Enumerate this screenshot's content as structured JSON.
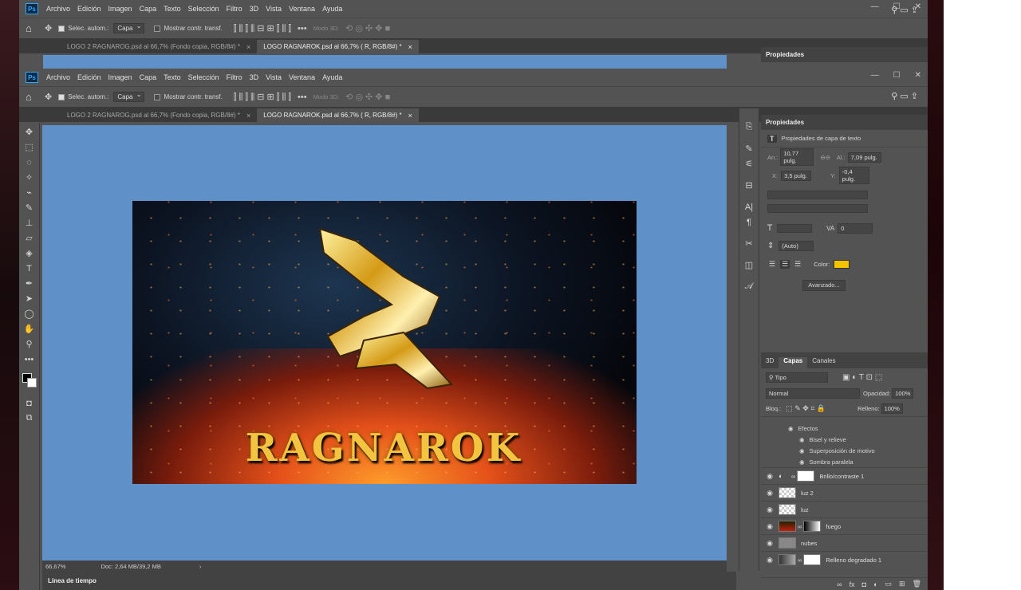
{
  "app_logo": "Ps",
  "menu": [
    "Archivo",
    "Edición",
    "Imagen",
    "Capa",
    "Texto",
    "Selección",
    "Filtro",
    "3D",
    "Vista",
    "Ventana",
    "Ayuda"
  ],
  "window_controls": {
    "minimize": "—",
    "maximize": "☐",
    "close": "✕"
  },
  "options": {
    "autoselect_label": "Selec. autom.:",
    "autoselect_value": "Capa",
    "transform_label": "Mostrar contr. transf.",
    "mode3d_label": "Modo 3D:",
    "more": "•••"
  },
  "tabs": [
    {
      "label": "LOGO 2 RAGNAROG.psd al 66,7% (Fondo copia, RGB/8#) *"
    },
    {
      "label": "LOGO RAGNAROK.psd al 66,7% ( R, RGB/8#) *"
    }
  ],
  "properties": {
    "title": "Propiedades",
    "subtitle": "Propiedades de capa de texto",
    "w_label": "An.:",
    "w_value": "10,77 pulg.",
    "h_label": "Al.:",
    "h_value": "7,09 pulg.",
    "x_label": "X:",
    "x_value": "3,5 pulg.",
    "y_label": "Y:",
    "y_value": "-0,4 pulg.",
    "tracking_value": "0",
    "leading_value": "(Auto)",
    "color_label": "Color:",
    "color": "#f5c400",
    "advanced_label": "Avanzado..."
  },
  "layers_panel": {
    "tabs": [
      "3D",
      "Capas",
      "Canales"
    ],
    "filter_label": "Tipo",
    "blend_mode": "Normal",
    "opacity_label": "Opacidad:",
    "opacity": "100%",
    "lock_label": "Bloq.:",
    "fill_label": "Relleno:",
    "fill": "100%",
    "effects_header": "Efectos",
    "effects": [
      "Bisel y relieve",
      "Superposición de motivo",
      "Sombra paralela"
    ],
    "layers": [
      "Brillo/contraste 1",
      "luz 2",
      "luz",
      "fuego",
      "nubes",
      "Relleno degradado 1"
    ]
  },
  "canvas": {
    "title_text": "RAGNAROK",
    "background": "#6090c8"
  },
  "status": {
    "zoom": "66,67%",
    "doc": "Doc: 2,64 MB/39,2 MB"
  },
  "timeline_label": "Línea de tiempo"
}
